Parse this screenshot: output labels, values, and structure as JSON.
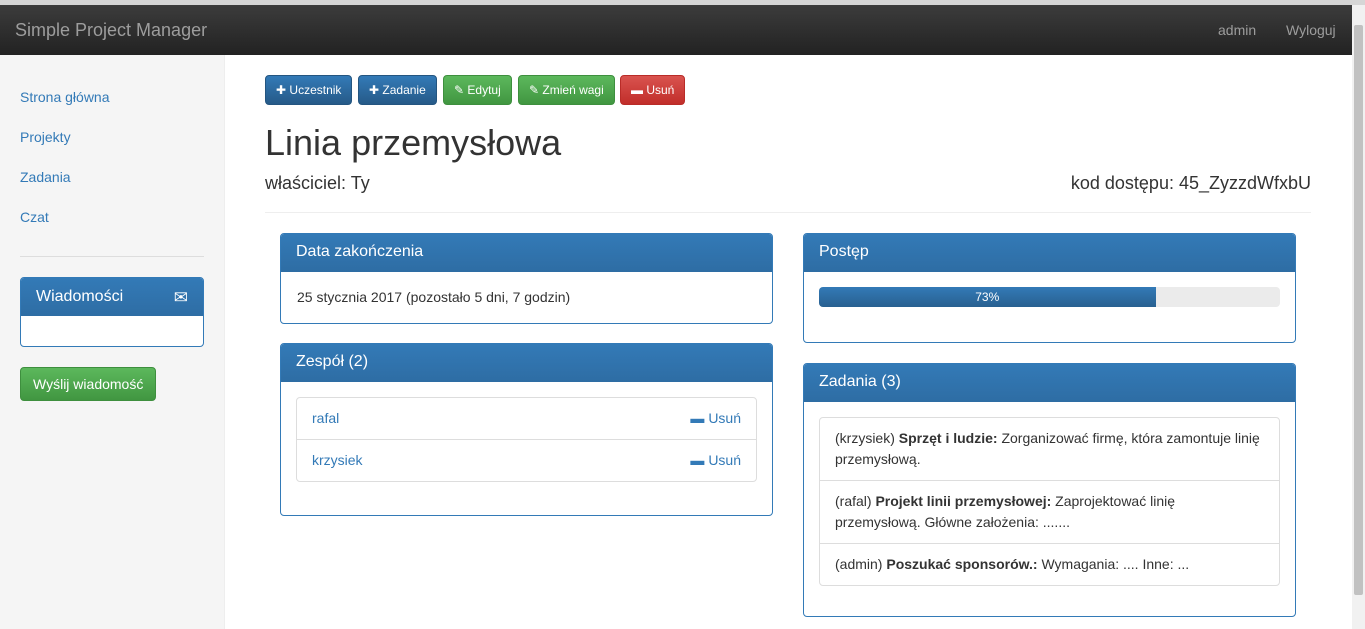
{
  "navbar": {
    "brand": "Simple Project Manager",
    "user": "admin",
    "logout": "Wyloguj"
  },
  "sidebar": {
    "items": [
      "Strona główna",
      "Projekty",
      "Zadania",
      "Czat"
    ],
    "messages_title": "Wiadomości",
    "send_button": "Wyślij wiadomość"
  },
  "toolbar": {
    "participant": "Uczestnik",
    "task": "Zadanie",
    "edit": "Edytuj",
    "weights": "Zmień wagi",
    "delete": "Usuń"
  },
  "project": {
    "title": "Linia przemysłowa",
    "owner": "właściciel: Ty",
    "access_code": "kod dostępu: 45_ZyzzdWfxbU"
  },
  "end_date": {
    "title": "Data zakończenia",
    "value": "25 stycznia 2017 (pozostało 5 dni, 7 godzin)"
  },
  "team": {
    "title": "Zespół (2)",
    "members": [
      {
        "name": "rafal",
        "remove": "Usuń"
      },
      {
        "name": "krzysiek",
        "remove": "Usuń"
      }
    ]
  },
  "progress": {
    "title": "Postęp",
    "percent": 73,
    "label": "73%"
  },
  "tasks": {
    "title": "Zadania (3)",
    "items": [
      {
        "user": "(krzysiek)",
        "name": "Sprzęt i ludzie:",
        "desc": "Zorganizować firmę, która zamontuje linię przemysłową."
      },
      {
        "user": "(rafal)",
        "name": "Projekt linii przemysłowej:",
        "desc": "Zaprojektować linię przemysłową. Główne założenia: ......."
      },
      {
        "user": "(admin)",
        "name": "Poszukać sponsorów.:",
        "desc": "Wymagania: .... Inne: ..."
      }
    ]
  }
}
